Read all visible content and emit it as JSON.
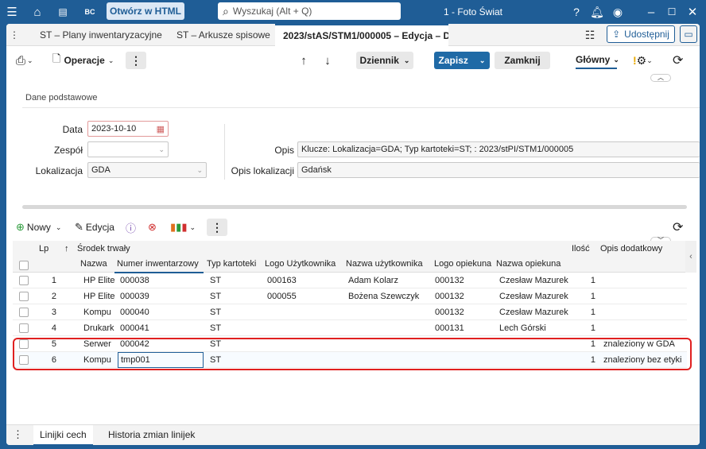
{
  "titlebar": {
    "open_html_label": "Otwórz w HTML",
    "search_placeholder": "Wyszukaj (Alt + Q)",
    "app_title": "1 - Foto Świat",
    "menu_icon": "hamburger-icon",
    "window_controls": [
      "minimize",
      "maximize",
      "close"
    ]
  },
  "tabs": [
    {
      "label": "ST – Plany inwentaryzacyjne"
    },
    {
      "label": "ST – Arkusze spisowe"
    },
    {
      "label": "2023/stAS/STM1/000005 – Edycja – D"
    }
  ],
  "share_label": "Udostępnij",
  "toolbar": {
    "operations_label": "Operacje",
    "journal_label": "Dziennik",
    "save_label": "Zapisz",
    "close_label": "Zamknij",
    "view_label": "Główny"
  },
  "form": {
    "section_title": "Dane podstawowe",
    "date_label": "Data",
    "date_value": "2023-10-10",
    "team_label": "Zespół",
    "team_value": "",
    "location_label": "Lokalizacja",
    "location_value": "GDA",
    "desc_label": "Opis",
    "desc_value": "Klucze: Lokalizacja=GDA; Typ kartoteki=ST;  : 2023/stPI/STM1/000005",
    "loc_desc_label": "Opis lokalizacji",
    "loc_desc_value": "Gdańsk"
  },
  "grid_toolbar": {
    "new_label": "Nowy",
    "edit_label": "Edycja"
  },
  "grid": {
    "headers": {
      "lp": "Lp",
      "asset_group": "Środek trwały",
      "name": "Nazwa",
      "inv_number": "Numer inwentarzowy",
      "card_type": "Typ kartoteki",
      "user_logo": "Logo Użytkownika",
      "user_name": "Nazwa użytkownika",
      "caretaker_logo": "Logo opiekuna",
      "caretaker_name": "Nazwa opiekuna",
      "qty": "Ilość",
      "extra_desc": "Opis dodatkowy"
    },
    "rows": [
      {
        "lp": "1",
        "name": "HP Elite",
        "inv": "000038",
        "type": "ST",
        "user_logo": "000163",
        "user_name": "Adam Kolarz",
        "care_logo": "000132",
        "care_name": "Czesław Mazurek",
        "qty": "1",
        "extra": ""
      },
      {
        "lp": "2",
        "name": "HP Elite",
        "inv": "000039",
        "type": "ST",
        "user_logo": "000055",
        "user_name": "Bożena Szewczyk",
        "care_logo": "000132",
        "care_name": "Czesław Mazurek",
        "qty": "1",
        "extra": ""
      },
      {
        "lp": "3",
        "name": "Kompu",
        "inv": "000040",
        "type": "ST",
        "user_logo": "",
        "user_name": "",
        "care_logo": "000132",
        "care_name": "Czesław Mazurek",
        "qty": "1",
        "extra": ""
      },
      {
        "lp": "4",
        "name": "Drukark",
        "inv": "000041",
        "type": "ST",
        "user_logo": "",
        "user_name": "",
        "care_logo": "000131",
        "care_name": "Lech Górski",
        "qty": "1",
        "extra": ""
      },
      {
        "lp": "5",
        "name": "Serwer",
        "inv": "000042",
        "type": "ST",
        "user_logo": "",
        "user_name": "",
        "care_logo": "",
        "care_name": "",
        "qty": "1",
        "extra": "znaleziony w GDA"
      },
      {
        "lp": "6",
        "name": "Kompu",
        "inv": "tmp001",
        "type": "ST",
        "user_logo": "",
        "user_name": "",
        "care_logo": "",
        "care_name": "",
        "qty": "1",
        "extra": "znaleziony bez etyki"
      }
    ]
  },
  "bottom_tabs": [
    {
      "label": "Linijki cech"
    },
    {
      "label": "Historia zmian linijek"
    }
  ],
  "colors": {
    "brand": "#1f5d96",
    "highlight": "#e02020",
    "save": "#1f6aa6"
  }
}
